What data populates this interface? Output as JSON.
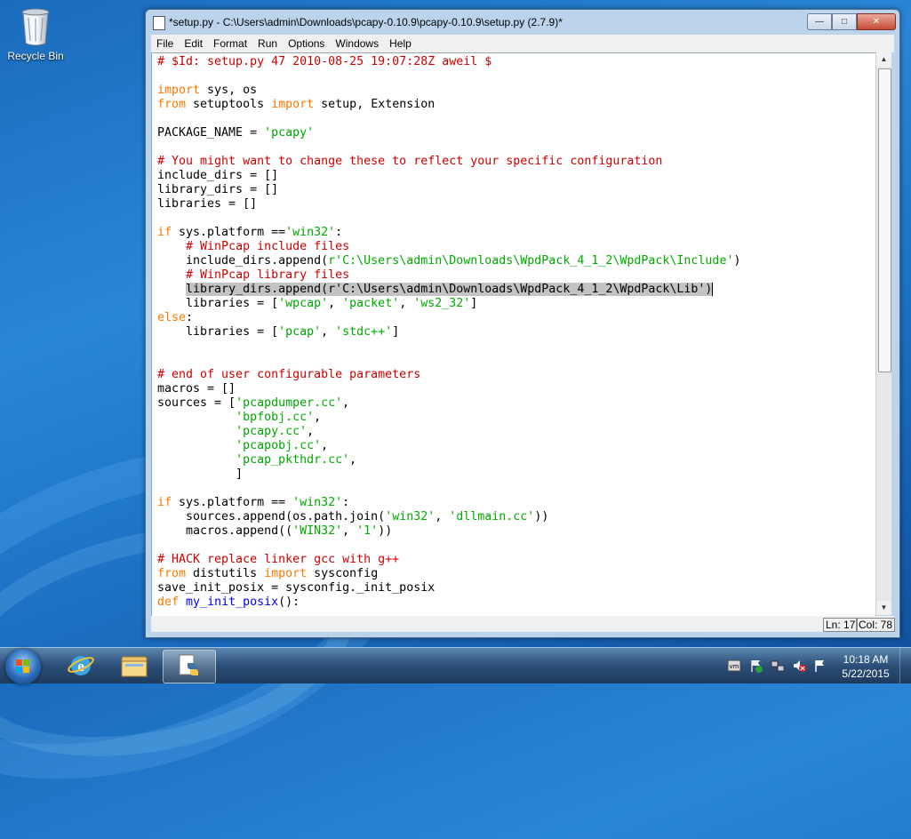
{
  "desktop": {
    "recycle_bin_label": "Recycle Bin"
  },
  "window": {
    "title": "*setup.py - C:\\Users\\admin\\Downloads\\pcapy-0.10.9\\pcapy-0.10.9\\setup.py (2.7.9)*",
    "menu": [
      "File",
      "Edit",
      "Format",
      "Run",
      "Options",
      "Windows",
      "Help"
    ],
    "status": {
      "line": "Ln: 17",
      "col": "Col: 78"
    }
  },
  "editor": {
    "lines": [
      [
        [
          "cm",
          "# $Id: setup.py 47 2010-08-25 19:07:28Z aweil $"
        ]
      ],
      [],
      [
        [
          "kw",
          "import"
        ],
        [
          "n",
          " sys, os"
        ]
      ],
      [
        [
          "kw",
          "from"
        ],
        [
          "n",
          " setuptools "
        ],
        [
          "kw",
          "import"
        ],
        [
          "n",
          " setup, Extension"
        ]
      ],
      [],
      [
        [
          "n",
          "PACKAGE_NAME = "
        ],
        [
          "st",
          "'pcapy'"
        ]
      ],
      [],
      [
        [
          "cm",
          "# You might want to change these to reflect your specific configuration"
        ]
      ],
      [
        [
          "n",
          "include_dirs = []"
        ]
      ],
      [
        [
          "n",
          "library_dirs = []"
        ]
      ],
      [
        [
          "n",
          "libraries = []"
        ]
      ],
      [],
      [
        [
          "kw",
          "if"
        ],
        [
          "n",
          " sys.platform =="
        ],
        [
          "st",
          "'win32'"
        ],
        [
          "n",
          ":"
        ]
      ],
      [
        [
          "n",
          "    "
        ],
        [
          "cm",
          "# WinPcap include files"
        ]
      ],
      [
        [
          "n",
          "    include_dirs.append("
        ],
        [
          "st",
          "r'C:\\Users\\admin\\Downloads\\WpdPack_4_1_2\\WpdPack\\Include'"
        ],
        [
          "n",
          ")"
        ]
      ],
      [
        [
          "n",
          "    "
        ],
        [
          "cm",
          "# WinPcap library files"
        ]
      ],
      [
        [
          "n",
          "    "
        ],
        [
          "sel",
          "library_dirs.append(r'C:\\Users\\admin\\Downloads\\WpdPack_4_1_2\\WpdPack\\Lib')"
        ],
        [
          "cur",
          ""
        ]
      ],
      [
        [
          "n",
          "    libraries = ["
        ],
        [
          "st",
          "'wpcap'"
        ],
        [
          "n",
          ", "
        ],
        [
          "st",
          "'packet'"
        ],
        [
          "n",
          ", "
        ],
        [
          "st",
          "'ws2_32'"
        ],
        [
          "n",
          "]"
        ]
      ],
      [
        [
          "kw",
          "else"
        ],
        [
          "n",
          ":"
        ]
      ],
      [
        [
          "n",
          "    libraries = ["
        ],
        [
          "st",
          "'pcap'"
        ],
        [
          "n",
          ", "
        ],
        [
          "st",
          "'stdc++'"
        ],
        [
          "n",
          "]"
        ]
      ],
      [],
      [],
      [
        [
          "cm",
          "# end of user configurable parameters"
        ]
      ],
      [
        [
          "n",
          "macros = []"
        ]
      ],
      [
        [
          "n",
          "sources = ["
        ],
        [
          "st",
          "'pcapdumper.cc'"
        ],
        [
          "n",
          ","
        ]
      ],
      [
        [
          "n",
          "           "
        ],
        [
          "st",
          "'bpfobj.cc'"
        ],
        [
          "n",
          ","
        ]
      ],
      [
        [
          "n",
          "           "
        ],
        [
          "st",
          "'pcapy.cc'"
        ],
        [
          "n",
          ","
        ]
      ],
      [
        [
          "n",
          "           "
        ],
        [
          "st",
          "'pcapobj.cc'"
        ],
        [
          "n",
          ","
        ]
      ],
      [
        [
          "n",
          "           "
        ],
        [
          "st",
          "'pcap_pkthdr.cc'"
        ],
        [
          "n",
          ","
        ]
      ],
      [
        [
          "n",
          "           ]"
        ]
      ],
      [],
      [
        [
          "kw",
          "if"
        ],
        [
          "n",
          " sys.platform == "
        ],
        [
          "st",
          "'win32'"
        ],
        [
          "n",
          ":"
        ]
      ],
      [
        [
          "n",
          "    sources.append(os.path.join("
        ],
        [
          "st",
          "'win32'"
        ],
        [
          "n",
          ", "
        ],
        [
          "st",
          "'dllmain.cc'"
        ],
        [
          "n",
          "))"
        ]
      ],
      [
        [
          "n",
          "    macros.append(("
        ],
        [
          "st",
          "'WIN32'"
        ],
        [
          "n",
          ", "
        ],
        [
          "st",
          "'1'"
        ],
        [
          "n",
          "))"
        ]
      ],
      [],
      [
        [
          "cm",
          "# HACK replace linker gcc with g++"
        ]
      ],
      [
        [
          "kw",
          "from"
        ],
        [
          "n",
          " distutils "
        ],
        [
          "kw",
          "import"
        ],
        [
          "n",
          " sysconfig"
        ]
      ],
      [
        [
          "n",
          "save_init_posix = sysconfig._init_posix"
        ]
      ],
      [
        [
          "kw",
          "def"
        ],
        [
          "n",
          " "
        ],
        [
          "df",
          "my_init_posix"
        ],
        [
          "n",
          "():"
        ]
      ]
    ]
  },
  "taskbar": {
    "time": "10:18 AM",
    "date": "5/22/2015"
  }
}
